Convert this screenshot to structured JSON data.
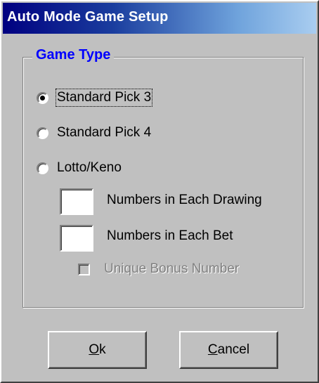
{
  "window": {
    "title": "Auto Mode Game Setup"
  },
  "game_type": {
    "legend": "Game Type",
    "options": [
      {
        "label": "Standard Pick 3",
        "selected": true
      },
      {
        "label": "Standard Pick 4",
        "selected": false
      },
      {
        "label": "Lotto/Keno",
        "selected": false
      }
    ],
    "numbers_in_drawing": {
      "label": "Numbers in Each Drawing",
      "value": ""
    },
    "numbers_in_bet": {
      "label": "Numbers in Each Bet",
      "value": ""
    },
    "unique_bonus": {
      "label": "Unique Bonus Number",
      "checked": false,
      "enabled": false
    }
  },
  "buttons": {
    "ok": {
      "accel": "O",
      "rest": "k"
    },
    "cancel": {
      "accel": "C",
      "rest": "ancel"
    }
  }
}
